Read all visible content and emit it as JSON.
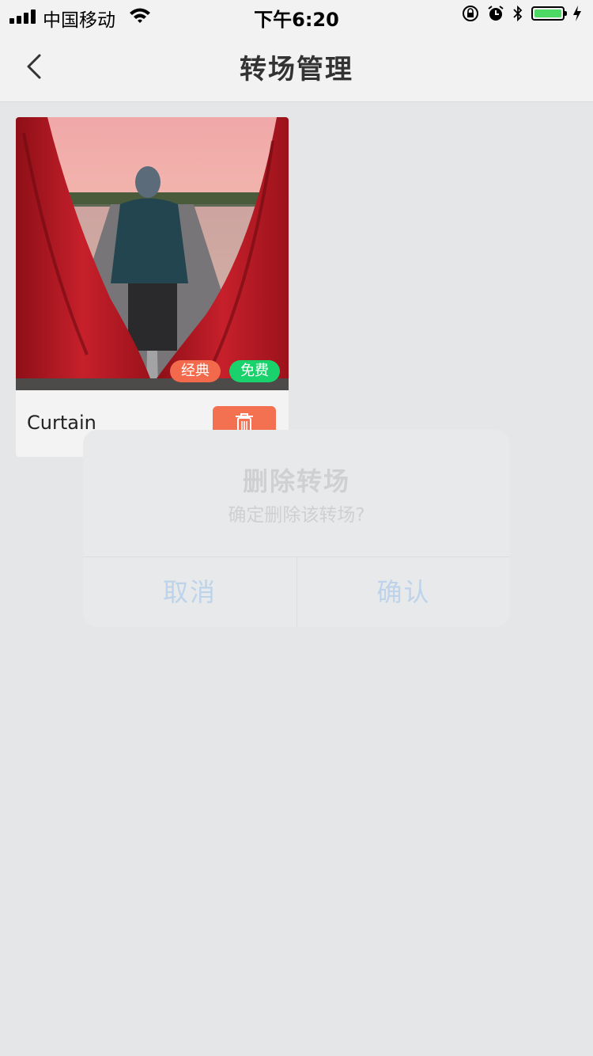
{
  "status_bar": {
    "carrier": "中国移动",
    "time": "下午6:20"
  },
  "nav": {
    "title": "转场管理"
  },
  "transitions": [
    {
      "name": "Curtain",
      "tags": [
        "经典",
        "免费"
      ],
      "tag_colors": [
        "#f26a4b",
        "#19d26b"
      ]
    }
  ],
  "dialog": {
    "title": "删除转场",
    "message": "确定删除该转场?",
    "cancel_label": "取消",
    "confirm_label": "确认"
  },
  "colors": {
    "accent": "#f37150",
    "background": "#e5e6e8"
  }
}
